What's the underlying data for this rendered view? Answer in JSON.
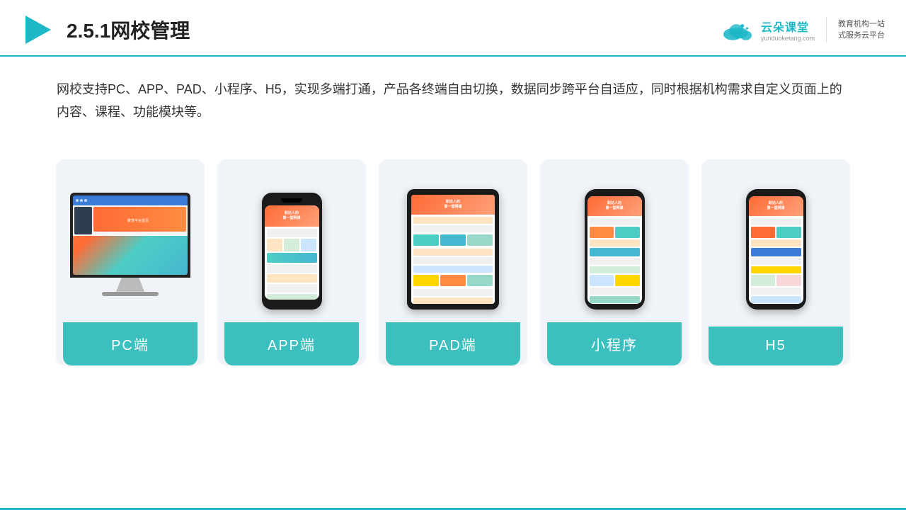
{
  "header": {
    "title": "2.5.1网校管理",
    "logo": {
      "main_text": "云朵课堂",
      "url_text": "yunduoketang.com",
      "slogan_line1": "教育机构一站",
      "slogan_line2": "式服务云平台"
    }
  },
  "description": {
    "text": "网校支持PC、APP、PAD、小程序、H5，实现多端打通，产品各终端自由切换，数据同步跨平台自适应，同时根据机构需求自定义页面上的内容、课程、功能模块等。"
  },
  "cards": [
    {
      "id": "pc",
      "label": "PC端"
    },
    {
      "id": "app",
      "label": "APP端"
    },
    {
      "id": "pad",
      "label": "PAD端"
    },
    {
      "id": "miniapp",
      "label": "小程序"
    },
    {
      "id": "h5",
      "label": "H5"
    }
  ],
  "colors": {
    "teal": "#3bbfbf",
    "header_border": "#1db8c8",
    "bg_card": "#f0f4f8"
  }
}
